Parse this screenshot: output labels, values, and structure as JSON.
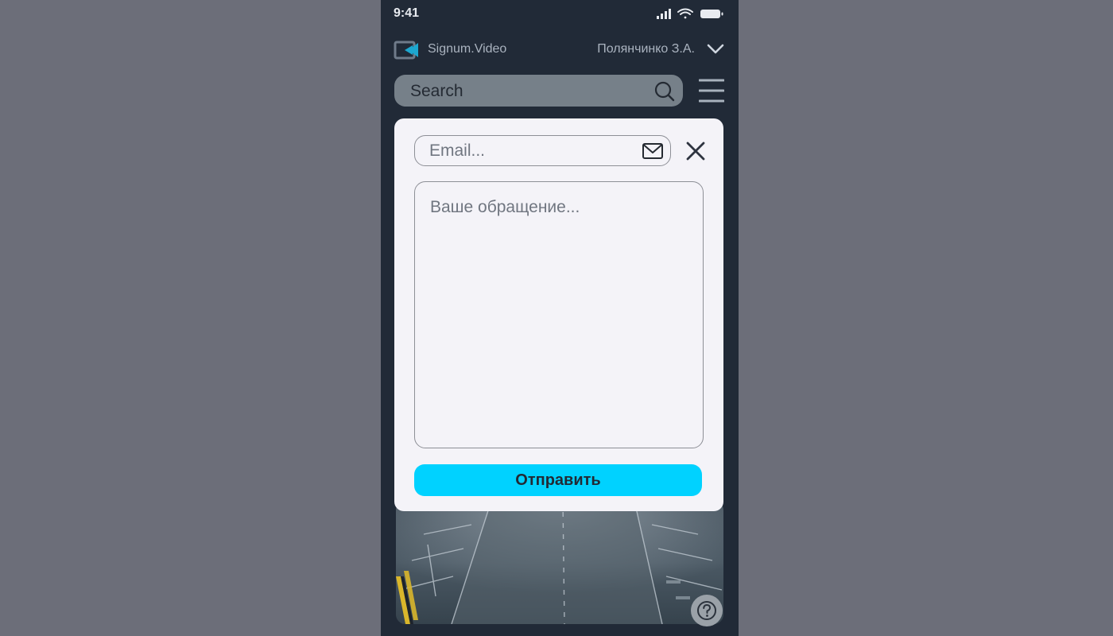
{
  "status_bar": {
    "time": "9:41"
  },
  "header": {
    "brand": "Signum.Video",
    "user_name": "Полянчинко З.А."
  },
  "search": {
    "placeholder": "Search"
  },
  "modal": {
    "email_placeholder": "Email...",
    "message_placeholder": "Ваше обращение...",
    "submit_label": "Отправить"
  },
  "icons": {
    "logo": "video-camera-icon",
    "user_menu": "chevron-down-icon",
    "search": "search-icon",
    "menu": "hamburger-menu-icon",
    "email": "mail-icon",
    "close": "close-icon",
    "help": "help-circle-icon"
  },
  "colors": {
    "page_background": "#6c6e79",
    "app_background": "#212a37",
    "modal_background": "#f4f3f8",
    "accent": "#00d2ff",
    "logo_accent": "#1da7cf"
  }
}
